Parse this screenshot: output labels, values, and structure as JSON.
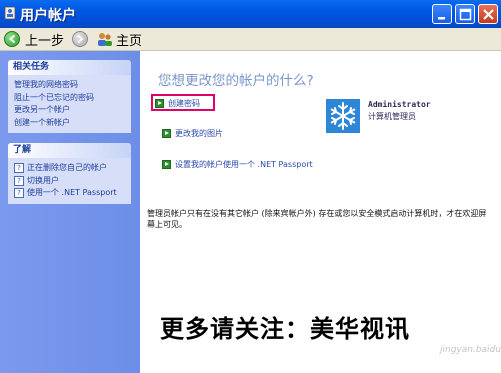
{
  "window": {
    "title": "用户帐户"
  },
  "toolbar": {
    "back_label": "上一步",
    "home_label": "主页"
  },
  "sidebar": {
    "related_tasks": {
      "title": "相关任务",
      "items": [
        "管理我的网络密码",
        "阻止一个已忘记的密码",
        "更改另一个帐户",
        "创建一个新帐户"
      ]
    },
    "learn": {
      "title": "了解",
      "items": [
        "正在删除您自己的帐户",
        "切换用户",
        "使用一个 .NET Passport"
      ]
    }
  },
  "main": {
    "title": "您想更改您的帐户的什么?",
    "tasks": [
      "创建密码",
      "更改我的图片",
      "设置我的帐户使用一个 .NET Passport"
    ],
    "account_name": "Administrator",
    "account_role": "计算机管理员",
    "note": "管理员帐户只有在没有其它帐户 (除来宾帐户外) 存在或您以安全模式启动计算机时，才在欢迎屏幕上可见。"
  },
  "overlay_caption": "更多请关注：美华视讯",
  "watermark": "jingyan.baidu.com",
  "colors": {
    "titlebar": "#0258e4",
    "sidebar": "#6d8ee8",
    "highlight": "#e0006a",
    "link": "#2a48a8"
  }
}
